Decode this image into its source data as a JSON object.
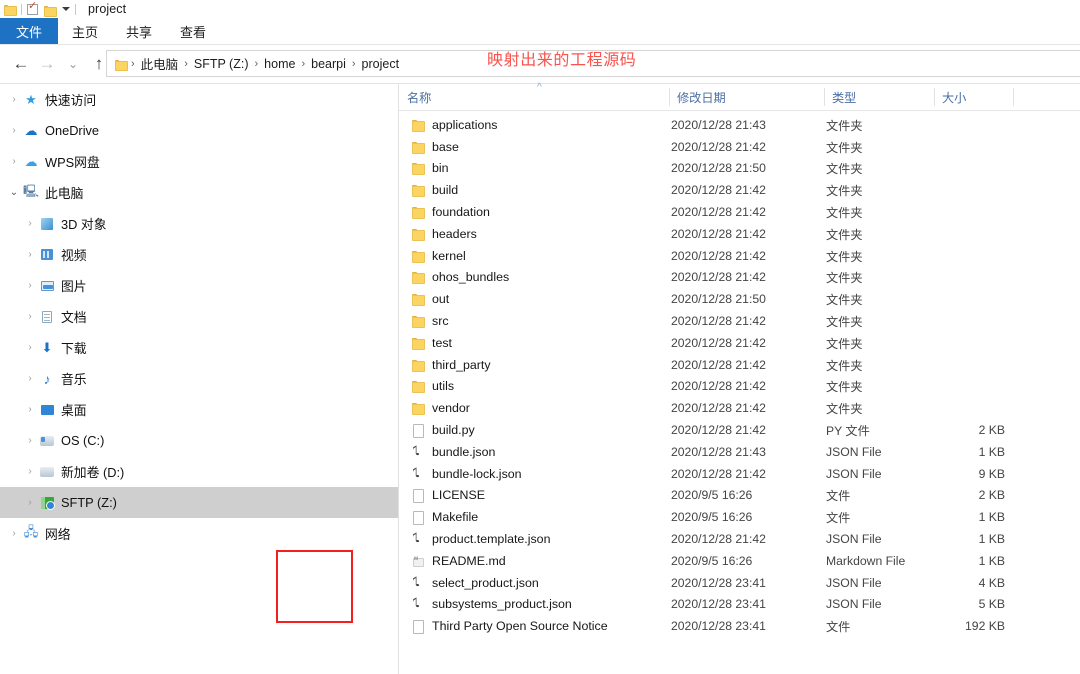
{
  "titlebar": {
    "icons": [
      "folder-icon",
      "properties-checkbox-icon",
      "folder-icon",
      "dropdown-caret-icon"
    ],
    "title": "project"
  },
  "ribbon": {
    "tabs": [
      {
        "label": "文件",
        "active": true
      },
      {
        "label": "主页",
        "active": false
      },
      {
        "label": "共享",
        "active": false
      },
      {
        "label": "查看",
        "active": false
      }
    ]
  },
  "nav": {
    "back_icon": "←",
    "forward_icon": "→",
    "history_icon": "⌄",
    "up_icon": "↑"
  },
  "breadcrumb": {
    "separator": "›",
    "items": [
      "此电脑",
      "SFTP (Z:)",
      "home",
      "bearpi",
      "project"
    ]
  },
  "annotations": {
    "red_text": "映射出来的工程源码",
    "red_text_color": "#f8534e",
    "red_box_color": "#f4201f"
  },
  "sidebar": {
    "items": [
      {
        "label": "快速访问",
        "icon": "star-icon",
        "indent": 0,
        "expander": "collapsed",
        "selected": false
      },
      {
        "label": "OneDrive",
        "icon": "cloud-icon",
        "indent": 0,
        "expander": "collapsed",
        "selected": false
      },
      {
        "label": "WPS网盘",
        "icon": "wps-cloud-icon",
        "indent": 0,
        "expander": "collapsed",
        "selected": false
      },
      {
        "label": "此电脑",
        "icon": "pc-icon",
        "indent": 0,
        "expander": "expanded",
        "selected": false
      },
      {
        "label": "3D 对象",
        "icon": "3d-objects-icon",
        "indent": 1,
        "expander": "collapsed",
        "selected": false
      },
      {
        "label": "视频",
        "icon": "video-icon",
        "indent": 1,
        "expander": "collapsed",
        "selected": false
      },
      {
        "label": "图片",
        "icon": "pictures-icon",
        "indent": 1,
        "expander": "collapsed",
        "selected": false
      },
      {
        "label": "文档",
        "icon": "documents-icon",
        "indent": 1,
        "expander": "collapsed",
        "selected": false
      },
      {
        "label": "下载",
        "icon": "downloads-icon",
        "indent": 1,
        "expander": "collapsed",
        "selected": false
      },
      {
        "label": "音乐",
        "icon": "music-icon",
        "indent": 1,
        "expander": "collapsed",
        "selected": false
      },
      {
        "label": "桌面",
        "icon": "desktop-icon",
        "indent": 1,
        "expander": "collapsed",
        "selected": false
      },
      {
        "label": "OS (C:)",
        "icon": "drive-icon",
        "indent": 1,
        "expander": "collapsed",
        "selected": false
      },
      {
        "label": "新加卷 (D:)",
        "icon": "drive-plain-icon",
        "indent": 1,
        "expander": "collapsed",
        "selected": false
      },
      {
        "label": "SFTP (Z:)",
        "icon": "sftp-drive-icon",
        "indent": 1,
        "expander": "collapsed",
        "selected": true
      },
      {
        "label": "网络",
        "icon": "network-icon",
        "indent": 0,
        "expander": "collapsed",
        "selected": false
      }
    ]
  },
  "filelist": {
    "columns": [
      {
        "key": "name",
        "label": "名称",
        "sorted": "asc"
      },
      {
        "key": "date",
        "label": "修改日期",
        "sorted": null
      },
      {
        "key": "type",
        "label": "类型",
        "sorted": null
      },
      {
        "key": "size",
        "label": "大小",
        "sorted": null
      }
    ],
    "rows": [
      {
        "name": "applications",
        "date": "2020/12/28 21:43",
        "type": "文件夹",
        "size": "",
        "icon": "folder-icon"
      },
      {
        "name": "base",
        "date": "2020/12/28 21:42",
        "type": "文件夹",
        "size": "",
        "icon": "folder-icon"
      },
      {
        "name": "bin",
        "date": "2020/12/28 21:50",
        "type": "文件夹",
        "size": "",
        "icon": "folder-icon"
      },
      {
        "name": "build",
        "date": "2020/12/28 21:42",
        "type": "文件夹",
        "size": "",
        "icon": "folder-icon"
      },
      {
        "name": "foundation",
        "date": "2020/12/28 21:42",
        "type": "文件夹",
        "size": "",
        "icon": "folder-icon"
      },
      {
        "name": "headers",
        "date": "2020/12/28 21:42",
        "type": "文件夹",
        "size": "",
        "icon": "folder-icon"
      },
      {
        "name": "kernel",
        "date": "2020/12/28 21:42",
        "type": "文件夹",
        "size": "",
        "icon": "folder-icon"
      },
      {
        "name": "ohos_bundles",
        "date": "2020/12/28 21:42",
        "type": "文件夹",
        "size": "",
        "icon": "folder-icon"
      },
      {
        "name": "out",
        "date": "2020/12/28 21:50",
        "type": "文件夹",
        "size": "",
        "icon": "folder-icon"
      },
      {
        "name": "src",
        "date": "2020/12/28 21:42",
        "type": "文件夹",
        "size": "",
        "icon": "folder-icon"
      },
      {
        "name": "test",
        "date": "2020/12/28 21:42",
        "type": "文件夹",
        "size": "",
        "icon": "folder-icon"
      },
      {
        "name": "third_party",
        "date": "2020/12/28 21:42",
        "type": "文件夹",
        "size": "",
        "icon": "folder-icon"
      },
      {
        "name": "utils",
        "date": "2020/12/28 21:42",
        "type": "文件夹",
        "size": "",
        "icon": "folder-icon"
      },
      {
        "name": "vendor",
        "date": "2020/12/28 21:42",
        "type": "文件夹",
        "size": "",
        "icon": "folder-icon"
      },
      {
        "name": "build.py",
        "date": "2020/12/28 21:42",
        "type": "PY 文件",
        "size": "2 KB",
        "icon": "file-icon"
      },
      {
        "name": "bundle.json",
        "date": "2020/12/28 21:43",
        "type": "JSON File",
        "size": "1 KB",
        "icon": "json-icon"
      },
      {
        "name": "bundle-lock.json",
        "date": "2020/12/28 21:42",
        "type": "JSON File",
        "size": "9 KB",
        "icon": "json-icon"
      },
      {
        "name": "LICENSE",
        "date": "2020/9/5 16:26",
        "type": "文件",
        "size": "2 KB",
        "icon": "file-icon"
      },
      {
        "name": "Makefile",
        "date": "2020/9/5 16:26",
        "type": "文件",
        "size": "1 KB",
        "icon": "file-icon"
      },
      {
        "name": "product.template.json",
        "date": "2020/12/28 21:42",
        "type": "JSON File",
        "size": "1 KB",
        "icon": "json-icon"
      },
      {
        "name": "README.md",
        "date": "2020/9/5 16:26",
        "type": "Markdown File",
        "size": "1 KB",
        "icon": "md-icon"
      },
      {
        "name": "select_product.json",
        "date": "2020/12/28 23:41",
        "type": "JSON File",
        "size": "4 KB",
        "icon": "json-icon"
      },
      {
        "name": "subsystems_product.json",
        "date": "2020/12/28 23:41",
        "type": "JSON File",
        "size": "5 KB",
        "icon": "json-icon"
      },
      {
        "name": "Third Party Open Source Notice",
        "date": "2020/12/28 23:41",
        "type": "文件",
        "size": "192 KB",
        "icon": "file-icon"
      }
    ]
  }
}
